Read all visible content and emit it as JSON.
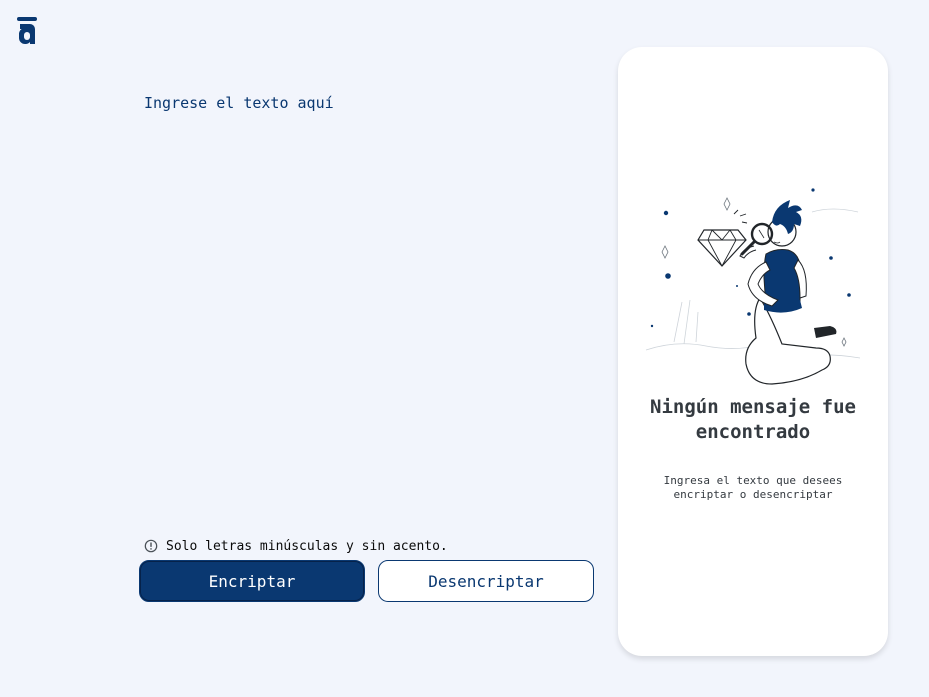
{
  "logo": {
    "icon": "alura-logo-icon",
    "letter": "a"
  },
  "editor": {
    "placeholder": "Ingrese el texto aquí",
    "value": ""
  },
  "hint": {
    "icon": "info-icon",
    "text": "Solo letras minúsculas y sin acento."
  },
  "buttons": {
    "encrypt_label": "Encriptar",
    "decrypt_label": "Desencriptar"
  },
  "output_panel": {
    "illustration": "person-with-magnifying-glass-illustration",
    "title": "Ningún mensaje fue encontrado",
    "message": "Ingresa el texto que desees encriptar o desencriptar"
  },
  "colors": {
    "background": "#f2f5fc",
    "primary": "#0a3871",
    "card": "#ffffff",
    "text_dark": "#343a40"
  }
}
